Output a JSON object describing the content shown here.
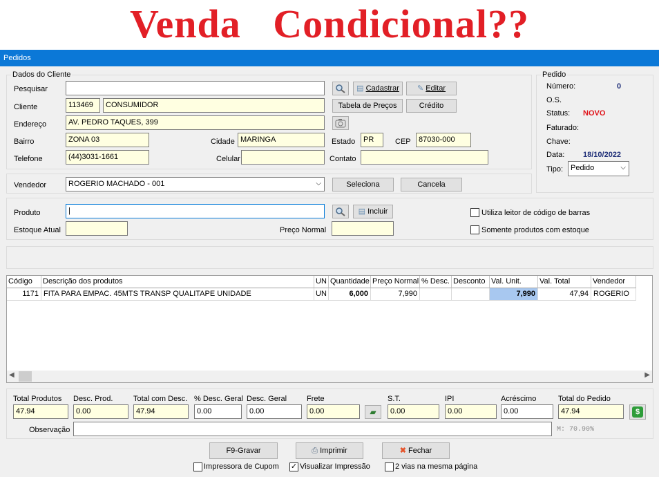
{
  "banner": {
    "title": "Venda   Condicional??"
  },
  "window": {
    "title": "Pedidos"
  },
  "cliente": {
    "group": "Dados do Cliente",
    "pesquisar_label": "Pesquisar",
    "pesquisar_value": "",
    "cadastrar": "Cadastrar",
    "editar": "Editar",
    "cliente_label": "Cliente",
    "cliente_codigo": "113469",
    "cliente_nome": "CONSUMIDOR",
    "tabela_precos": "Tabela de Preços",
    "credito": "Crédito",
    "endereco_label": "Endereço",
    "endereco": "AV. PEDRO TAQUES, 399",
    "bairro_label": "Bairro",
    "bairro": "ZONA 03",
    "cidade_label": "Cidade",
    "cidade": "MARINGA",
    "estado_label": "Estado",
    "estado": "PR",
    "cep_label": "CEP",
    "cep": "87030-000",
    "telefone_label": "Telefone",
    "telefone": "(44)3031-1661",
    "celular_label": "Celular",
    "celular": "",
    "contato_label": "Contato",
    "contato": ""
  },
  "pedido": {
    "group": "Pedido",
    "numero_label": "Número:",
    "numero": "0",
    "os_label": "O.S.",
    "status_label": "Status:",
    "status": "NOVO",
    "faturado_label": "Faturado:",
    "chave_label": "Chave:",
    "data_label": "Data:",
    "data": "18/10/2022",
    "tipo_label": "Tipo:",
    "tipo": "Pedido"
  },
  "vendedor": {
    "label": "Vendedor",
    "value": "ROGERIO MACHADO - 001",
    "seleciona": "Seleciona",
    "cancela": "Cancela"
  },
  "produto": {
    "label": "Produto",
    "value": "",
    "incluir": "Incluir",
    "estoque_label": "Estoque Atual",
    "estoque": "",
    "preco_label": "Preço Normal",
    "preco": "",
    "leitor": "Utiliza leitor de código de barras",
    "somente": "Somente produtos com estoque"
  },
  "grid": {
    "headers": [
      "Código",
      "Descrição dos produtos",
      "UN",
      "Quantidade",
      "Preço Normal",
      "% Desc.",
      "Desconto",
      "Val. Unit.",
      "Val. Total",
      "Vendedor"
    ],
    "rows": [
      [
        "1171",
        "FITA PARA EMPAC. 45MTS TRANSP QUALITAPE UNIDADE",
        "UN",
        "6,000",
        "7,990",
        "",
        "",
        "7,990",
        "47,94",
        "ROGERIO"
      ]
    ]
  },
  "totals": {
    "labels": [
      "Total Produtos",
      "Desc. Prod.",
      "Total com Desc.",
      "% Desc. Geral",
      "Desc. Geral",
      "Frete",
      "S.T.",
      "IPI",
      "Acréscimo",
      "Total do Pedido"
    ],
    "values": [
      "47.94",
      "0.00",
      "47.94",
      "0.00",
      "0.00",
      "0.00",
      "0.00",
      "0.00",
      "0.00",
      "47.94"
    ]
  },
  "observacao": {
    "label": "Observação",
    "value": "",
    "margin": "M: 70.90%"
  },
  "footer": {
    "gravar": "F9-Gravar",
    "imprimir": "Imprimir",
    "fechar": "Fechar",
    "cupom": "Impressora de Cupom",
    "visualizar": "Visualizar Impressão",
    "vias": "2 vias na mesma página"
  }
}
